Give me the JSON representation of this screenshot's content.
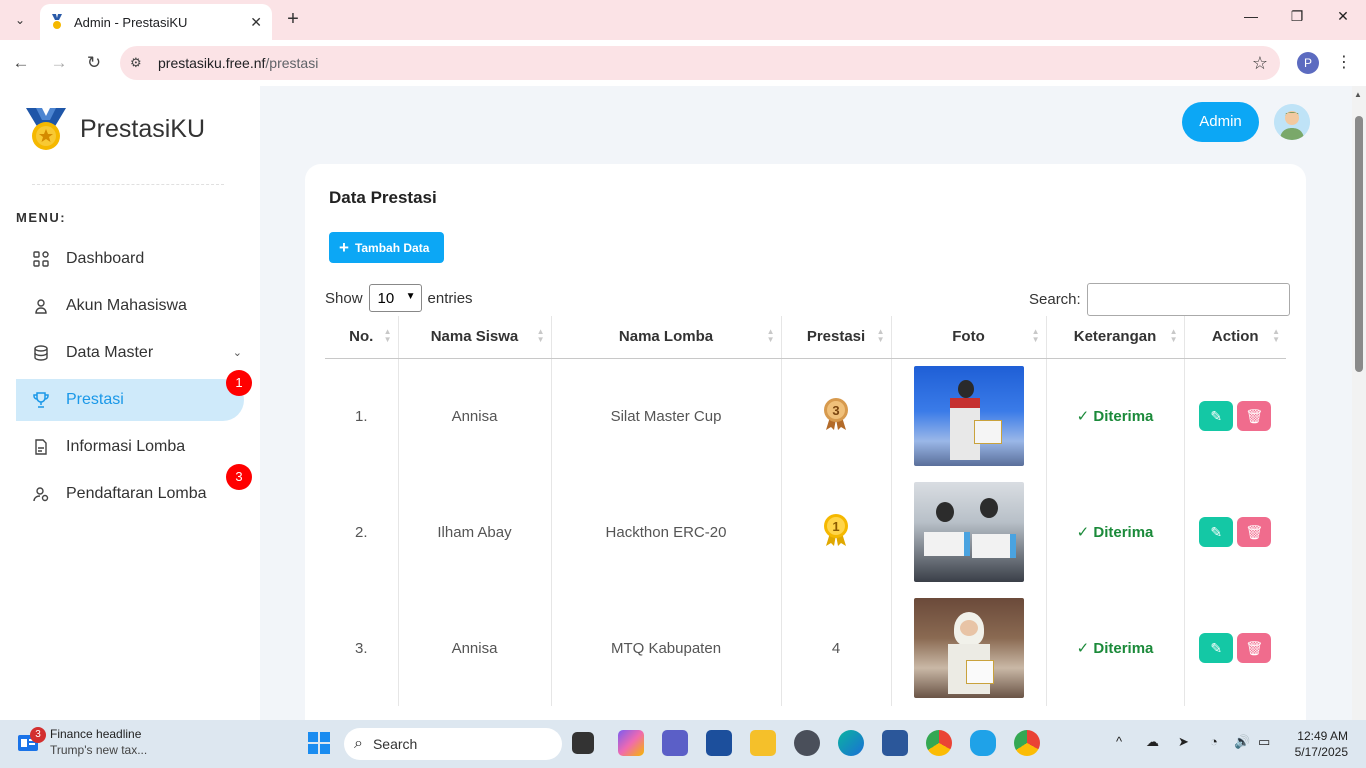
{
  "browser": {
    "tab_title": "Admin - PrestasiKU",
    "url_host": "prestasiku.free.nf",
    "url_path": "/prestasi",
    "profile_initial": "P"
  },
  "sidebar": {
    "brand": "PrestasiKU",
    "menu_label": "MENU:",
    "items": [
      {
        "label": "Dashboard",
        "icon": "dashboard-icon"
      },
      {
        "label": "Akun Mahasiswa",
        "icon": "user-icon"
      },
      {
        "label": "Data Master",
        "icon": "database-icon"
      },
      {
        "label": "Prestasi",
        "icon": "trophy-icon",
        "active": true,
        "badge": "1"
      },
      {
        "label": "Informasi Lomba",
        "icon": "document-icon"
      },
      {
        "label": "Pendaftaran Lomba",
        "icon": "user-settings-icon",
        "badge": "3"
      }
    ]
  },
  "header": {
    "admin_label": "Admin"
  },
  "main": {
    "title": "Data Prestasi",
    "add_button": "Tambah Data",
    "show_label": "Show",
    "entries_value": "10",
    "entries_label": "entries",
    "search_label": "Search:",
    "columns": [
      "No.",
      "Nama Siswa",
      "Nama Lomba",
      "Prestasi",
      "Foto",
      "Keterangan",
      "Action"
    ],
    "rows": [
      {
        "no": "1.",
        "nama": "Annisa",
        "lomba": "Silat Master Cup",
        "prestasi": "3",
        "prestasi_type": "medal",
        "keterangan": "Diterima"
      },
      {
        "no": "2.",
        "nama": "Ilham Abay",
        "lomba": "Hackthon ERC-20",
        "prestasi": "1",
        "prestasi_type": "medal",
        "keterangan": "Diterima"
      },
      {
        "no": "3.",
        "nama": "Annisa",
        "lomba": "MTQ Kabupaten",
        "prestasi": "4",
        "prestasi_type": "text",
        "keterangan": "Diterima"
      }
    ]
  },
  "taskbar": {
    "news_badge": "3",
    "news_title": "Finance headline",
    "news_sub": "Trump's new tax...",
    "search_placeholder": "Search",
    "time": "12:49 AM",
    "date": "5/17/2025"
  },
  "colors": {
    "accent": "#0ca7f5",
    "active_bg": "#cfeafa",
    "badge": "#ff0000",
    "edit": "#14c8a5",
    "delete": "#f06c8d",
    "status": "#1b8a3a"
  }
}
